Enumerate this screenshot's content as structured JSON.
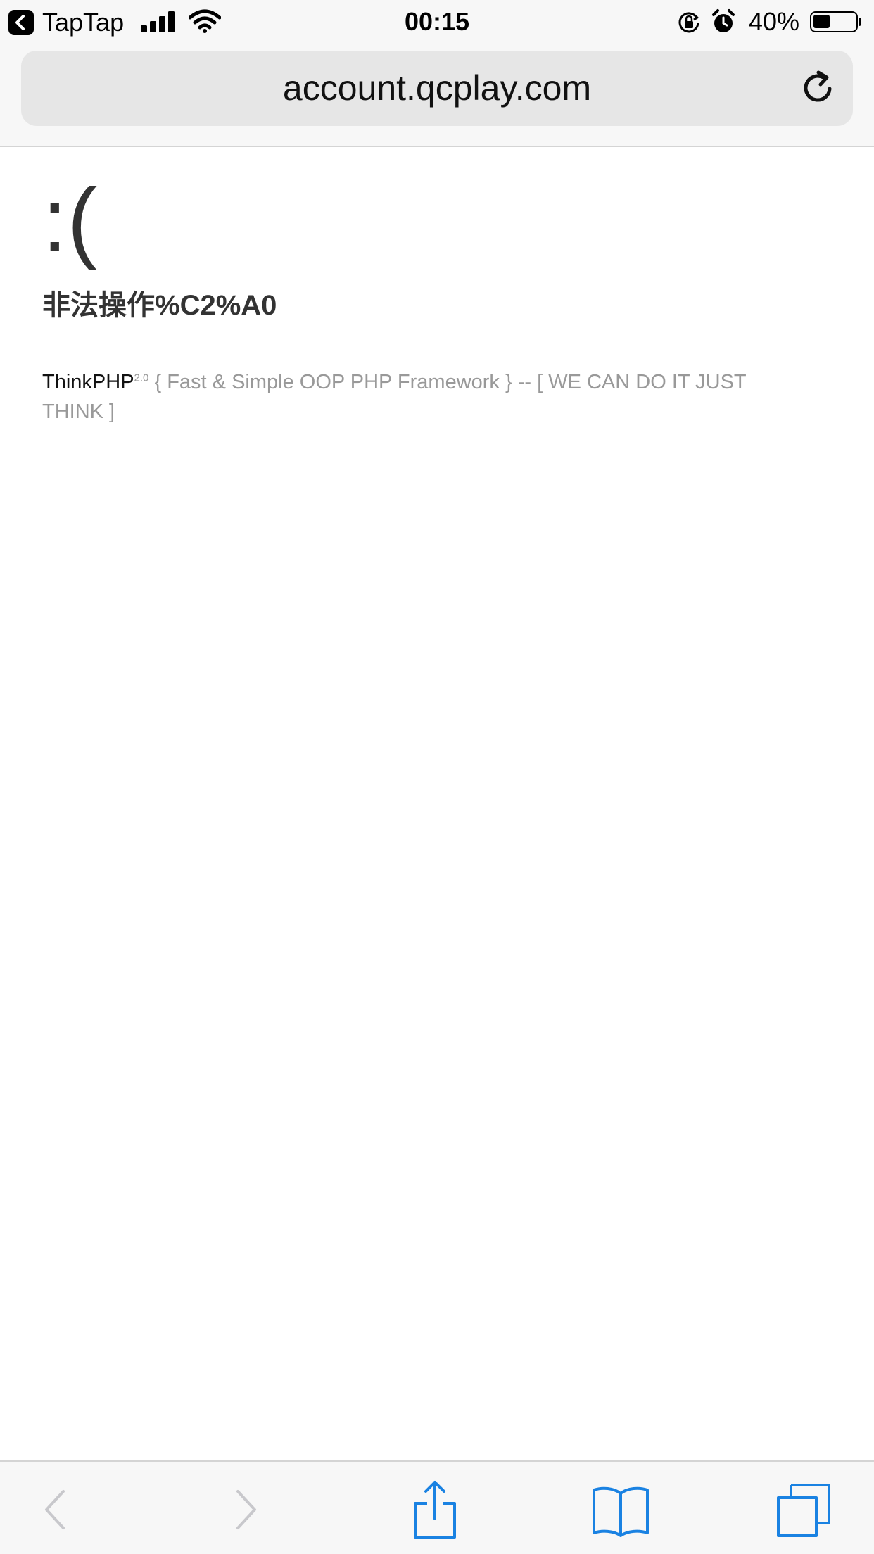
{
  "status_bar": {
    "back_app": "TapTap",
    "time": "00:15",
    "battery_percent": "40%",
    "battery_level": 0.4,
    "icons": [
      "back-arrow-icon",
      "cellular-signal-icon",
      "wifi-icon",
      "rotation-lock-icon",
      "alarm-icon",
      "battery-icon"
    ]
  },
  "address_bar": {
    "url": "account.qcplay.com",
    "reload_icon": "reload-icon"
  },
  "page": {
    "face": ":(",
    "error_message": "非法操作%C2%A0",
    "brand": "ThinkPHP",
    "version": "2.0",
    "tagline": " { Fast & Simple OOP PHP Framework } -- [ WE CAN DO IT JUST THINK ]"
  },
  "toolbar": {
    "items": [
      "back-icon",
      "forward-icon",
      "share-icon",
      "bookmarks-icon",
      "tabs-icon"
    ],
    "colors": {
      "active": "#1a82e2",
      "disabled": "#c8c8cc"
    }
  },
  "colors": {
    "chrome_background": "#f7f7f7",
    "url_field": "#e6e6e6",
    "heading_text": "#333333",
    "muted_text": "#999999"
  }
}
